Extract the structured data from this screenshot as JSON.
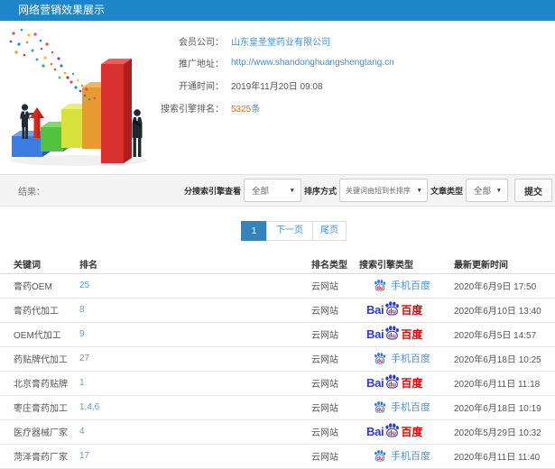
{
  "header": {
    "title": "网络营销效果展示"
  },
  "colors": {
    "topbar": "#1e86c8",
    "link_blue": "#3e8fd4",
    "rank_blue": "#5b9dd9",
    "highlight_orange": "#ff6600",
    "baidu_blue": "#2b39dd",
    "baidu_red": "#e10602"
  },
  "info": {
    "fields": [
      {
        "label": "会员公司：",
        "value": "山东皇圣堂药业有限公司"
      },
      {
        "label": "推广地址：",
        "value": "http://www.shandonghuangshengtang.cn"
      },
      {
        "label": "开通时间：",
        "value": "2019年11月20日 09:08"
      },
      {
        "label": "搜索引擎排名：",
        "value": "5325",
        "suffix": "条"
      }
    ]
  },
  "filters": {
    "result_label": "结果：",
    "engine_view_label": "分搜索引擎查看",
    "engine_view_value": "全部",
    "sort_label": "排序方式",
    "sort_value": "关键词由短到长排序",
    "article_type_label": "文章类型",
    "article_type_value": "全部",
    "submit_label": "提交"
  },
  "pagination": {
    "current": "1",
    "next": "下一页",
    "last": "尾页"
  },
  "table": {
    "headers": [
      "关键词",
      "排名",
      "排名类型",
      "搜索引擎类型",
      "最新更新时间"
    ],
    "rows": [
      {
        "keyword": "膏药OEM",
        "rank": "25",
        "rank_type": "云网站",
        "engine": "mobile",
        "updated": "2020年6月9日 17:50"
      },
      {
        "keyword": "膏药代加工",
        "rank": "8",
        "rank_type": "云网站",
        "engine": "desktop",
        "updated": "2020年6月10日 13:40"
      },
      {
        "keyword": "OEM代加工",
        "rank": "9",
        "rank_type": "云网站",
        "engine": "desktop",
        "updated": "2020年6月5日 14:57"
      },
      {
        "keyword": "药贴牌代加工",
        "rank": "27",
        "rank_type": "云网站",
        "engine": "mobile",
        "updated": "2020年6月18日 10:25"
      },
      {
        "keyword": "北京膏药贴牌",
        "rank": "1",
        "rank_type": "云网站",
        "engine": "desktop",
        "updated": "2020年6月11日 11:18"
      },
      {
        "keyword": "枣庄膏药加工",
        "rank": "1,4,6",
        "rank_type": "云网站",
        "engine": "mobile",
        "updated": "2020年6月18日 10:19"
      },
      {
        "keyword": "医疗器械厂家",
        "rank": "4",
        "rank_type": "云网站",
        "engine": "desktop",
        "updated": "2020年5月29日 10:32"
      },
      {
        "keyword": "菏泽膏药厂家",
        "rank": "17",
        "rank_type": "云网站",
        "engine": "mobile",
        "updated": "2020年6月11日 11:40"
      }
    ]
  },
  "branding": {
    "bai": "Bai",
    "du": "du",
    "baidu": "百度",
    "mobile_baidu": "手机百度"
  },
  "icons": {
    "caret": "▼"
  }
}
